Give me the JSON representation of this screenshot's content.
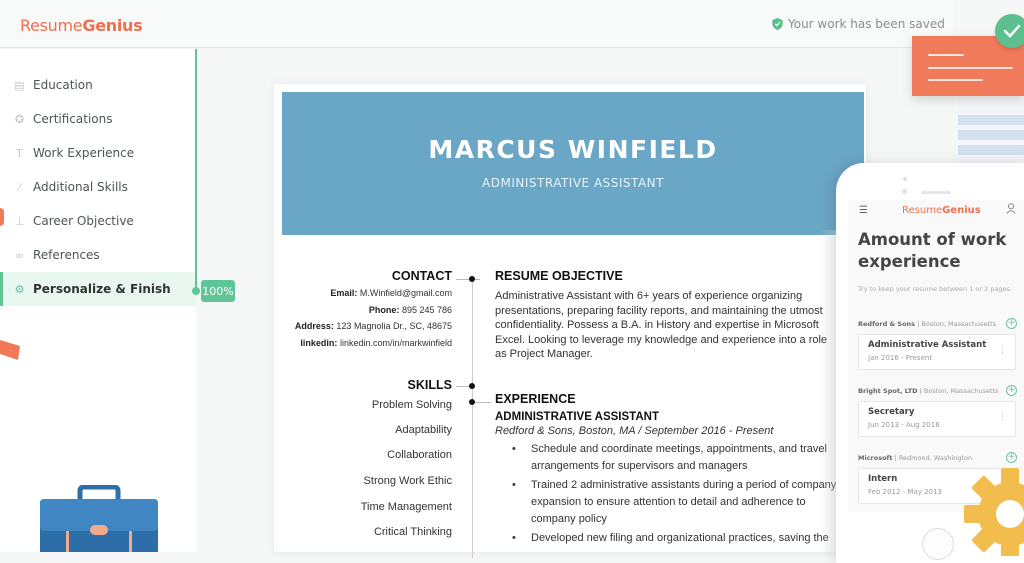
{
  "header": {
    "logo_regular": "Resume",
    "logo_bold": "Genius",
    "save_status": "Your work has been saved"
  },
  "sidebar": {
    "items": [
      {
        "label": "Education",
        "icon": "book-icon",
        "active": false
      },
      {
        "label": "Certifications",
        "icon": "award-icon",
        "active": false
      },
      {
        "label": "Work Experience",
        "icon": "hammer-icon",
        "active": false
      },
      {
        "label": "Additional Skills",
        "icon": "wand-icon",
        "active": false
      },
      {
        "label": "Career Objective",
        "icon": "stamp-icon",
        "active": false
      },
      {
        "label": "References",
        "icon": "link-icon",
        "active": false
      },
      {
        "label": "Personalize & Finish",
        "icon": "gear-icon",
        "active": true
      }
    ],
    "progress": "100%"
  },
  "resume": {
    "name": "MARCUS WINFIELD",
    "title": "ADMINISTRATIVE ASSISTANT",
    "contact": {
      "heading": "CONTACT",
      "rows": [
        {
          "label": "Email:",
          "value": "M.Winfield@gmail.com"
        },
        {
          "label": "Phone:",
          "value": "895 245  786"
        },
        {
          "label": "Address:",
          "value": "123 Magnolia Dr., SC, 48675"
        },
        {
          "label": "linkedin:",
          "value": "linkedin.com/in/markwinfield"
        }
      ]
    },
    "skills": {
      "heading": "SKILLS",
      "items": [
        "Problem Solving",
        "Adaptability",
        "Collaboration",
        "Strong Work Ethic",
        "Time Management",
        "Critical Thinking"
      ]
    },
    "objective": {
      "heading": "RESUME OBJECTIVE",
      "text": "Administrative Assistant with 6+ years of experience organizing presentations, preparing facility reports, and maintaining the utmost confidentiality.  Possess a B.A. in History and expertise in Microsoft Excel. Looking to leverage my knowledge and experience into a role as Project Manager."
    },
    "experience": {
      "heading": "EXPERIENCE",
      "job_title": "ADMINISTRATIVE ASSISTANT",
      "job_meta": "Redford & Sons, Boston, MA  /  September 2016 - Present",
      "bullets": [
        "Schedule and coordinate meetings, appointments, and travel arrangements for supervisors and managers",
        "Trained 2 administrative assistants during a period of company expansion to ensure attention to detail and adherence to company policy",
        "Developed new filing and organizational practices, saving the"
      ]
    }
  },
  "phone": {
    "logo_regular": "Resume",
    "logo_bold": "Genius",
    "title": "Amount of work experience",
    "hint": "Try to keep your resume between 1 or 2 pages.",
    "jobs": [
      {
        "company": "Redford & Sons",
        "location": "Boston, Massachusetts",
        "role": "Administrative Assistant",
        "dates": "Jan 2016 - Present"
      },
      {
        "company": "Bright Spot, LTD",
        "location": "Boston, Massachusetts",
        "role": "Secretary",
        "dates": "Jun 2013 - Aug 2016"
      },
      {
        "company": "Microsoft",
        "location": "Redmond, Washington",
        "role": "Intern",
        "dates": "Feb 2012 - May 2013"
      }
    ]
  },
  "colors": {
    "brand": "#ef6f4f",
    "accent_green": "#5fc597",
    "resume_header": "#6aa6c6"
  }
}
